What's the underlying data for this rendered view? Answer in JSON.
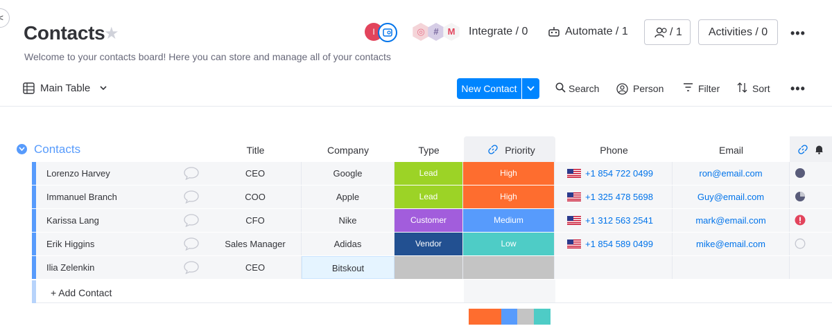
{
  "header": {
    "title": "Contacts",
    "description": "Welcome to your contacts board! Here you can store and manage all of your contacts",
    "avatar_initial": "I",
    "integrate_label": "Integrate / 0",
    "automate_label": "Automate / 1",
    "members_count": "/ 1",
    "activities_label": "Activities / 0",
    "more": "•••"
  },
  "toolbar": {
    "view_label": "Main Table",
    "new_button": "New Contact",
    "search": "Search",
    "person": "Person",
    "filter": "Filter",
    "sort": "Sort",
    "more": "•••"
  },
  "group": {
    "title": "Contacts",
    "columns": {
      "title": "Title",
      "company": "Company",
      "type": "Type",
      "priority": "Priority",
      "phone": "Phone",
      "email": "Email"
    },
    "rows": [
      {
        "name": "Lorenzo Harvey",
        "title": "CEO",
        "company": "Google",
        "type": "Lead",
        "type_color": "#9cd326",
        "priority": "High",
        "priority_color": "#fe6d2f",
        "phone": "+1 854 722 0499",
        "email": "ron@email.com",
        "status_icon": "dark-circle-icon"
      },
      {
        "name": "Immanuel Branch",
        "title": "COO",
        "company": "Apple",
        "type": "Lead",
        "type_color": "#9cd326",
        "priority": "High",
        "priority_color": "#fe6d2f",
        "phone": "+1 325 478 5698",
        "email": "Guy@email.com",
        "status_icon": "pie-circle-icon"
      },
      {
        "name": "Karissa Lang",
        "title": "CFO",
        "company": "Nike",
        "type": "Customer",
        "type_color": "#a25ddc",
        "priority": "Medium",
        "priority_color": "#579bfc",
        "phone": "+1 312 563 2541",
        "email": "mark@email.com",
        "status_icon": "alert-circle-icon"
      },
      {
        "name": "Erik Higgins",
        "title": "Sales Manager",
        "company": "Adidas",
        "type": "Vendor",
        "type_color": "#225091",
        "priority": "Low",
        "priority_color": "#4eccc6",
        "phone": "+1 854 589 0499",
        "email": "mike@email.com",
        "status_icon": "empty-circle-icon"
      },
      {
        "name": "Ilia Zelenkin",
        "title": "CEO",
        "company": "Bitskout",
        "type": "",
        "type_color": "#c4c4c4",
        "priority": "",
        "priority_color": "#c4c4c4",
        "phone": "",
        "email": "",
        "status_icon": ""
      }
    ],
    "add_label": "+ Add Contact",
    "priority_summary": [
      {
        "color": "#fe6d2f",
        "fraction": 0.4
      },
      {
        "color": "#579bfc",
        "fraction": 0.2
      },
      {
        "color": "#c4c4c4",
        "fraction": 0.2
      },
      {
        "color": "#4eccc6",
        "fraction": 0.2
      }
    ]
  }
}
